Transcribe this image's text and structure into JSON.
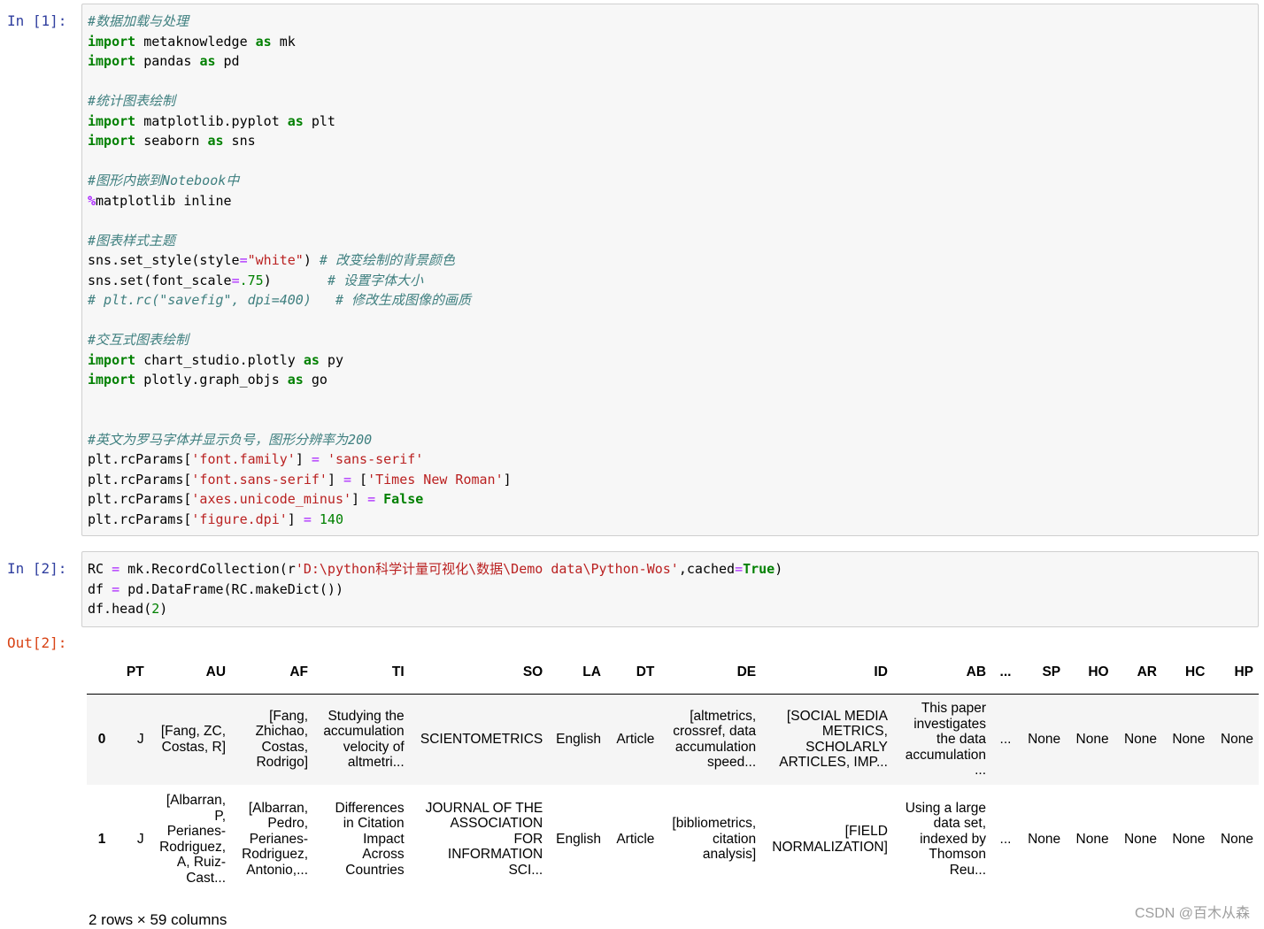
{
  "cell1": {
    "prompt": "In  [1]:",
    "lines": [
      [
        {
          "t": "#数据加载与处理",
          "c": "cm"
        }
      ],
      [
        {
          "t": "import",
          "c": "kw"
        },
        {
          "t": " metaknowledge "
        },
        {
          "t": "as",
          "c": "kw"
        },
        {
          "t": " mk"
        }
      ],
      [
        {
          "t": "import",
          "c": "kw"
        },
        {
          "t": " pandas "
        },
        {
          "t": "as",
          "c": "kw"
        },
        {
          "t": " pd"
        }
      ],
      [],
      [
        {
          "t": "#统计图表绘制",
          "c": "cm"
        }
      ],
      [
        {
          "t": "import",
          "c": "kw"
        },
        {
          "t": " matplotlib.pyplot "
        },
        {
          "t": "as",
          "c": "kw"
        },
        {
          "t": " plt"
        }
      ],
      [
        {
          "t": "import",
          "c": "kw"
        },
        {
          "t": " seaborn "
        },
        {
          "t": "as",
          "c": "kw"
        },
        {
          "t": " sns"
        }
      ],
      [],
      [
        {
          "t": "#图形内嵌到Notebook中",
          "c": "cm"
        }
      ],
      [
        {
          "t": "%",
          "c": "op"
        },
        {
          "t": "matplotlib inline"
        }
      ],
      [],
      [
        {
          "t": "#图表样式主题",
          "c": "cm"
        }
      ],
      [
        {
          "t": "sns.set_style(style"
        },
        {
          "t": "=",
          "c": "mg"
        },
        {
          "t": "\"white\"",
          "c": "st"
        },
        {
          "t": ") "
        },
        {
          "t": "# 改变绘制的背景颜色",
          "c": "cm"
        }
      ],
      [
        {
          "t": "sns.set(font_scale"
        },
        {
          "t": "=",
          "c": "mg"
        },
        {
          "t": ".75",
          "c": "nm"
        },
        {
          "t": ")       "
        },
        {
          "t": "# 设置字体大小",
          "c": "cm"
        }
      ],
      [
        {
          "t": "# plt.rc(\"savefig\", dpi=400)   # 修改生成图像的画质",
          "c": "cm"
        }
      ],
      [],
      [
        {
          "t": "#交互式图表绘制",
          "c": "cm"
        }
      ],
      [
        {
          "t": "import",
          "c": "kw"
        },
        {
          "t": " chart_studio.plotly "
        },
        {
          "t": "as",
          "c": "kw"
        },
        {
          "t": " py"
        }
      ],
      [
        {
          "t": "import",
          "c": "kw"
        },
        {
          "t": " plotly.graph_objs "
        },
        {
          "t": "as",
          "c": "kw"
        },
        {
          "t": " go"
        }
      ],
      [],
      [],
      [
        {
          "t": "#英文为罗马字体并显示负号，图形分辨率为200",
          "c": "cm"
        }
      ],
      [
        {
          "t": "plt.rcParams["
        },
        {
          "t": "'font.family'",
          "c": "st"
        },
        {
          "t": "] "
        },
        {
          "t": "=",
          "c": "mg"
        },
        {
          "t": " "
        },
        {
          "t": "'sans-serif'",
          "c": "st"
        }
      ],
      [
        {
          "t": "plt.rcParams["
        },
        {
          "t": "'font.sans-serif'",
          "c": "st"
        },
        {
          "t": "] "
        },
        {
          "t": "=",
          "c": "mg"
        },
        {
          "t": " ["
        },
        {
          "t": "'Times New Roman'",
          "c": "st"
        },
        {
          "t": "]"
        }
      ],
      [
        {
          "t": "plt.rcParams["
        },
        {
          "t": "'axes.unicode_minus'",
          "c": "st"
        },
        {
          "t": "] "
        },
        {
          "t": "=",
          "c": "mg"
        },
        {
          "t": " "
        },
        {
          "t": "False",
          "c": "kw"
        }
      ],
      [
        {
          "t": "plt.rcParams["
        },
        {
          "t": "'figure.dpi'",
          "c": "st"
        },
        {
          "t": "] "
        },
        {
          "t": "=",
          "c": "mg"
        },
        {
          "t": " "
        },
        {
          "t": "140",
          "c": "nm"
        }
      ]
    ]
  },
  "cell2": {
    "prompt": "In  [2]:",
    "out_prompt": "Out[2]:",
    "lines": [
      [
        {
          "t": "RC "
        },
        {
          "t": "=",
          "c": "mg"
        },
        {
          "t": " mk.RecordCollection(r"
        },
        {
          "t": "'D:\\python科学计量可视化\\数据\\Demo data\\Python-Wos'",
          "c": "st"
        },
        {
          "t": ",cached"
        },
        {
          "t": "=",
          "c": "mg"
        },
        {
          "t": "True",
          "c": "kw"
        },
        {
          "t": ")"
        }
      ],
      [
        {
          "t": "df "
        },
        {
          "t": "=",
          "c": "mg"
        },
        {
          "t": " pd.DataFrame(RC.makeDict())"
        }
      ],
      [
        {
          "t": "df.head("
        },
        {
          "t": "2",
          "c": "nm"
        },
        {
          "t": ")"
        }
      ]
    ]
  },
  "dataframe": {
    "columns": [
      "PT",
      "AU",
      "AF",
      "TI",
      "SO",
      "LA",
      "DT",
      "DE",
      "ID",
      "AB",
      "...",
      "SP",
      "HO",
      "AR",
      "HC",
      "HP"
    ],
    "rows": [
      {
        "index": "0",
        "cells": [
          "J",
          "[Fang, ZC,\nCostas, R]",
          "[Fang,\nZhichao,\nCostas,\nRodrigo]",
          "Studying the\naccumulation\nvelocity of\naltmetri...",
          "SCIENTOMETRICS",
          "English",
          "Article",
          "[altmetrics,\ncrossref, data\naccumulation\nspeed...",
          "[SOCIAL MEDIA\nMETRICS,\nSCHOLARLY\nARTICLES, IMP...",
          "This paper\ninvestigates\nthe data\naccumulation\n...",
          "...",
          "None",
          "None",
          "None",
          "None",
          "None"
        ]
      },
      {
        "index": "1",
        "cells": [
          "J",
          "[Albarran,\nP,\nPerianes-\nRodriguez,\nA, Ruiz-\nCast...",
          "[Albarran,\nPedro,\nPerianes-\nRodriguez,\nAntonio,...",
          "Differences\nin Citation\nImpact\nAcross\nCountries",
          "JOURNAL OF THE\nASSOCIATION\nFOR\nINFORMATION\nSCI...",
          "English",
          "Article",
          "[bibliometrics,\ncitation\nanalysis]",
          "[FIELD\nNORMALIZATION]",
          "Using a large\ndata set,\nindexed by\nThomson\nReu...",
          "...",
          "None",
          "None",
          "None",
          "None",
          "None"
        ]
      }
    ],
    "shape_text": "2 rows × 59 columns"
  },
  "watermark": "CSDN @百木从森"
}
